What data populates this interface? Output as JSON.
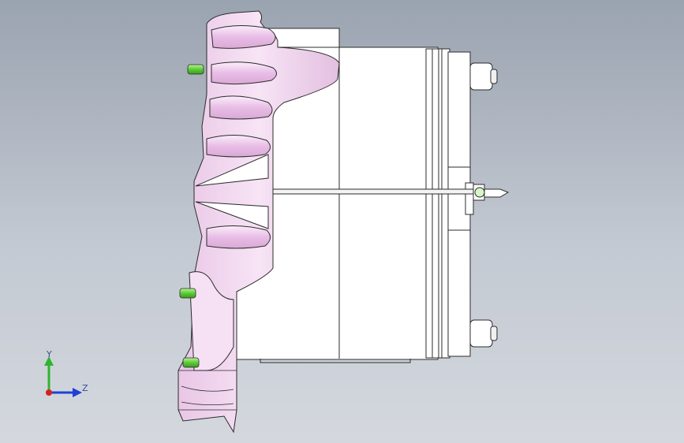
{
  "viewport": {
    "background_top": "#9aa3b0",
    "background_bottom": "#d4d8de",
    "part_colors": {
      "housing": "#ffffff",
      "shroud": "#f2d8f0",
      "edge": "#2b2b2b",
      "pins": "#6fd34a",
      "studs": "#ffffff"
    }
  },
  "triad": {
    "y_label": "Y",
    "z_label": "Z",
    "y_color": "#2fb52f",
    "z_color": "#1f3fd6",
    "x_color": "#d62020"
  }
}
